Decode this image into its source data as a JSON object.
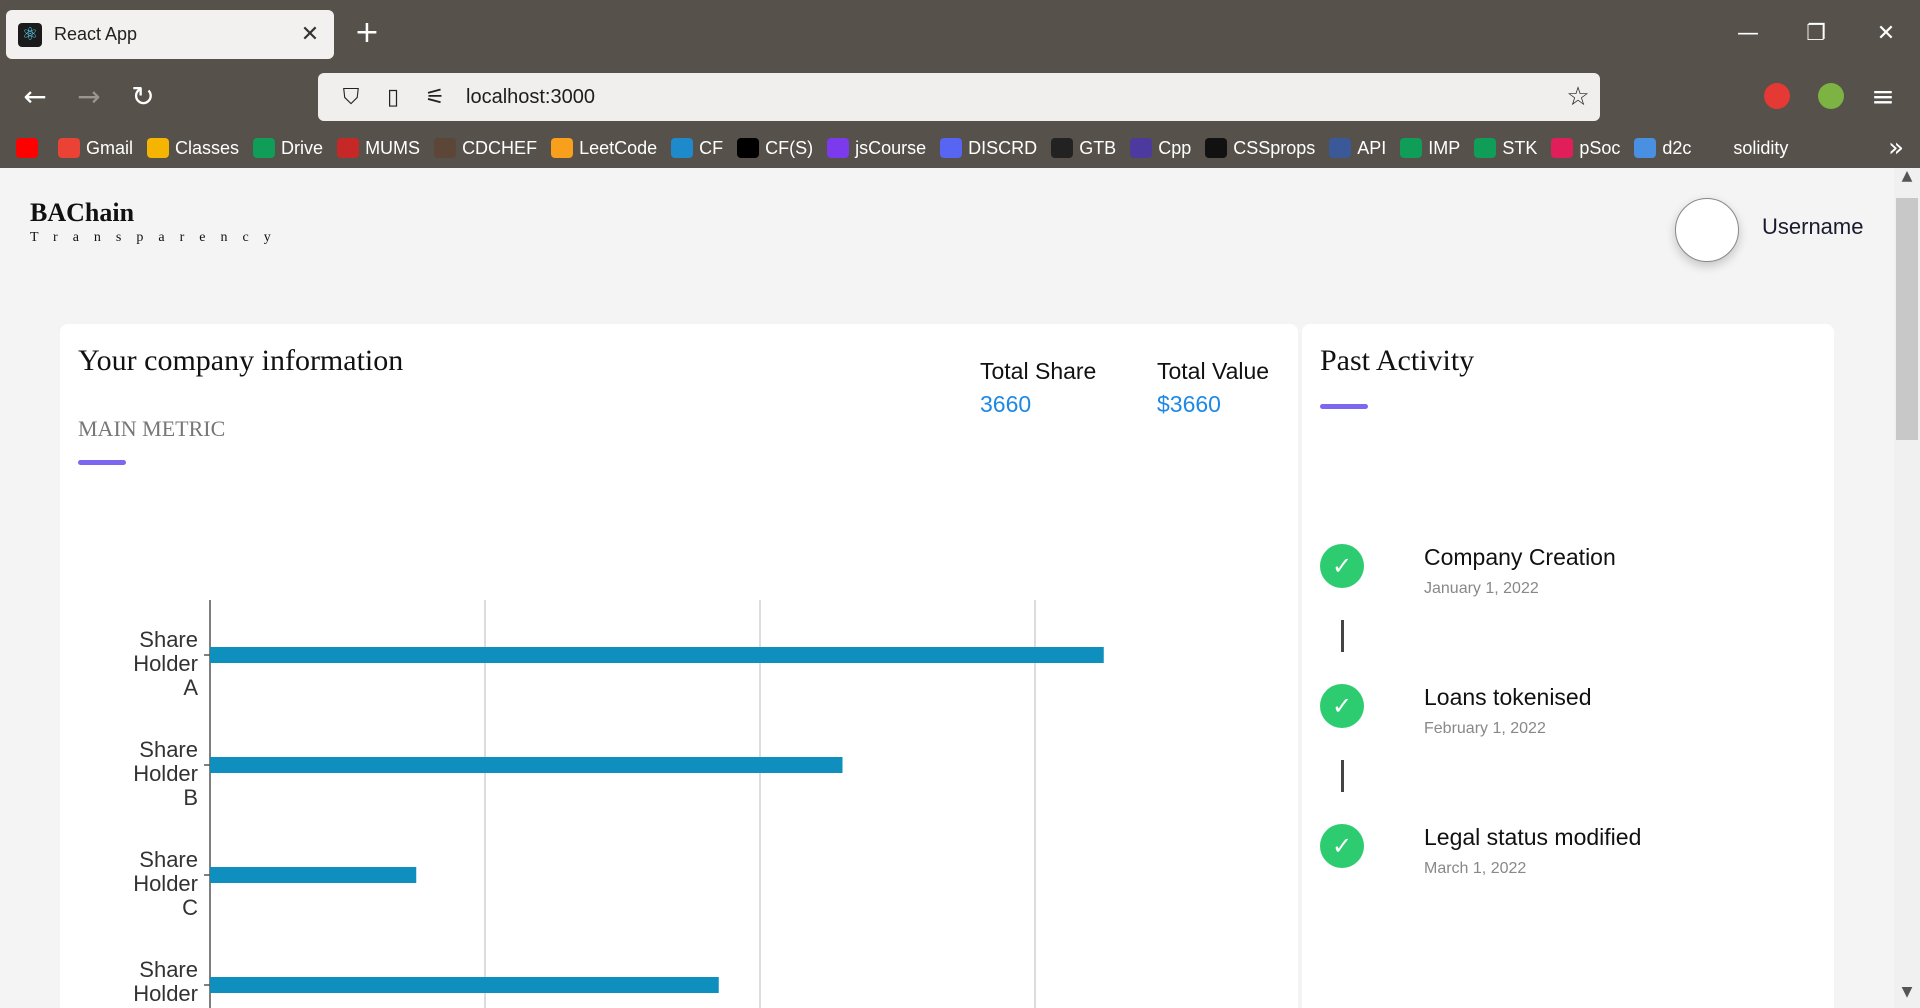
{
  "browser": {
    "tab_title": "React App",
    "url": "localhost:3000",
    "bookmarks": [
      {
        "label": "",
        "icon": "youtube-icon",
        "color": "#ff0000"
      },
      {
        "label": "Gmail",
        "icon": "gmail-icon",
        "color": "#ea4335"
      },
      {
        "label": "Classes",
        "icon": "classroom-icon",
        "color": "#f4b400"
      },
      {
        "label": "Drive",
        "icon": "drive-icon",
        "color": "#0f9d58"
      },
      {
        "label": "MUMS",
        "icon": "mums-icon",
        "color": "#c62828"
      },
      {
        "label": "CDCHEF",
        "icon": "codechef-icon",
        "color": "#5b4638"
      },
      {
        "label": "LeetCode",
        "icon": "leetcode-icon",
        "color": "#f89f1b"
      },
      {
        "label": "CF",
        "icon": "codeforces-icon",
        "color": "#1f8acb"
      },
      {
        "label": "CF(S)",
        "icon": "codeforces-s-icon",
        "color": "#000000"
      },
      {
        "label": "jsCourse",
        "icon": "jscourse-icon",
        "color": "#7c3aed"
      },
      {
        "label": "DISCRD",
        "icon": "discord-icon",
        "color": "#5865f2"
      },
      {
        "label": "GTB",
        "icon": "github-icon",
        "color": "#222222"
      },
      {
        "label": "Cpp",
        "icon": "cpp-icon",
        "color": "#4c3a9e"
      },
      {
        "label": "CSSprops",
        "icon": "cssprops-icon",
        "color": "#111111"
      },
      {
        "label": "API",
        "icon": "api-icon",
        "color": "#3b5998"
      },
      {
        "label": "IMP",
        "icon": "drive-imp-icon",
        "color": "#0f9d58"
      },
      {
        "label": "STK",
        "icon": "sheets-stk-icon",
        "color": "#0f9d58"
      },
      {
        "label": "pSoc",
        "icon": "slack-icon",
        "color": "#e01e5a"
      },
      {
        "label": "d2c",
        "icon": "d2c-icon",
        "color": "#4a90e2"
      },
      {
        "label": "solidity",
        "icon": "folder-icon",
        "color": "#56514a"
      }
    ]
  },
  "header": {
    "brand": "BAChain",
    "tagline": "Transparency",
    "username": "Username"
  },
  "info": {
    "title": "Your company information",
    "metric_label": "MAIN METRIC",
    "total_share_label": "Total Share",
    "total_share_value": "3660",
    "total_value_label": "Total Value",
    "total_value_value": "$3660"
  },
  "chart_data": {
    "type": "bar",
    "orientation": "horizontal",
    "categories": [
      "Share Holder A",
      "Share Holder B",
      "Share Holder C",
      "Share Holder D"
    ],
    "values": [
      1300,
      920,
      300,
      740
    ],
    "xlim": [
      0,
      1600
    ],
    "grid": true,
    "color": "#0e8fbe"
  },
  "activity": {
    "title": "Past Activity",
    "items": [
      {
        "title": "Company Creation",
        "date": "January 1, 2022"
      },
      {
        "title": "Loans tokenised",
        "date": "February 1, 2022"
      },
      {
        "title": "Legal status modified",
        "date": "March 1, 2022"
      }
    ]
  },
  "colors": {
    "accent": "#7b68ee",
    "link": "#1e88e5",
    "success": "#2ecc71",
    "chrome": "#56514a"
  }
}
